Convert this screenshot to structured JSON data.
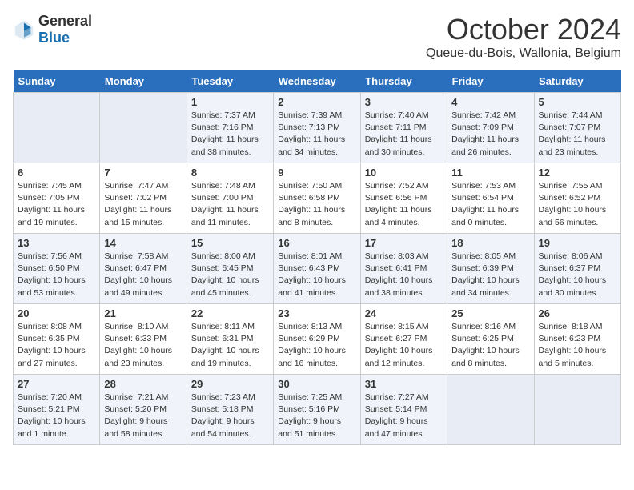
{
  "header": {
    "logo_general": "General",
    "logo_blue": "Blue",
    "month": "October 2024",
    "location": "Queue-du-Bois, Wallonia, Belgium"
  },
  "weekdays": [
    "Sunday",
    "Monday",
    "Tuesday",
    "Wednesday",
    "Thursday",
    "Friday",
    "Saturday"
  ],
  "weeks": [
    [
      {
        "day": "",
        "empty": true
      },
      {
        "day": "",
        "empty": true
      },
      {
        "day": "1",
        "sunrise": "Sunrise: 7:37 AM",
        "sunset": "Sunset: 7:16 PM",
        "daylight": "Daylight: 11 hours and 38 minutes."
      },
      {
        "day": "2",
        "sunrise": "Sunrise: 7:39 AM",
        "sunset": "Sunset: 7:13 PM",
        "daylight": "Daylight: 11 hours and 34 minutes."
      },
      {
        "day": "3",
        "sunrise": "Sunrise: 7:40 AM",
        "sunset": "Sunset: 7:11 PM",
        "daylight": "Daylight: 11 hours and 30 minutes."
      },
      {
        "day": "4",
        "sunrise": "Sunrise: 7:42 AM",
        "sunset": "Sunset: 7:09 PM",
        "daylight": "Daylight: 11 hours and 26 minutes."
      },
      {
        "day": "5",
        "sunrise": "Sunrise: 7:44 AM",
        "sunset": "Sunset: 7:07 PM",
        "daylight": "Daylight: 11 hours and 23 minutes."
      }
    ],
    [
      {
        "day": "6",
        "sunrise": "Sunrise: 7:45 AM",
        "sunset": "Sunset: 7:05 PM",
        "daylight": "Daylight: 11 hours and 19 minutes."
      },
      {
        "day": "7",
        "sunrise": "Sunrise: 7:47 AM",
        "sunset": "Sunset: 7:02 PM",
        "daylight": "Daylight: 11 hours and 15 minutes."
      },
      {
        "day": "8",
        "sunrise": "Sunrise: 7:48 AM",
        "sunset": "Sunset: 7:00 PM",
        "daylight": "Daylight: 11 hours and 11 minutes."
      },
      {
        "day": "9",
        "sunrise": "Sunrise: 7:50 AM",
        "sunset": "Sunset: 6:58 PM",
        "daylight": "Daylight: 11 hours and 8 minutes."
      },
      {
        "day": "10",
        "sunrise": "Sunrise: 7:52 AM",
        "sunset": "Sunset: 6:56 PM",
        "daylight": "Daylight: 11 hours and 4 minutes."
      },
      {
        "day": "11",
        "sunrise": "Sunrise: 7:53 AM",
        "sunset": "Sunset: 6:54 PM",
        "daylight": "Daylight: 11 hours and 0 minutes."
      },
      {
        "day": "12",
        "sunrise": "Sunrise: 7:55 AM",
        "sunset": "Sunset: 6:52 PM",
        "daylight": "Daylight: 10 hours and 56 minutes."
      }
    ],
    [
      {
        "day": "13",
        "sunrise": "Sunrise: 7:56 AM",
        "sunset": "Sunset: 6:50 PM",
        "daylight": "Daylight: 10 hours and 53 minutes."
      },
      {
        "day": "14",
        "sunrise": "Sunrise: 7:58 AM",
        "sunset": "Sunset: 6:47 PM",
        "daylight": "Daylight: 10 hours and 49 minutes."
      },
      {
        "day": "15",
        "sunrise": "Sunrise: 8:00 AM",
        "sunset": "Sunset: 6:45 PM",
        "daylight": "Daylight: 10 hours and 45 minutes."
      },
      {
        "day": "16",
        "sunrise": "Sunrise: 8:01 AM",
        "sunset": "Sunset: 6:43 PM",
        "daylight": "Daylight: 10 hours and 41 minutes."
      },
      {
        "day": "17",
        "sunrise": "Sunrise: 8:03 AM",
        "sunset": "Sunset: 6:41 PM",
        "daylight": "Daylight: 10 hours and 38 minutes."
      },
      {
        "day": "18",
        "sunrise": "Sunrise: 8:05 AM",
        "sunset": "Sunset: 6:39 PM",
        "daylight": "Daylight: 10 hours and 34 minutes."
      },
      {
        "day": "19",
        "sunrise": "Sunrise: 8:06 AM",
        "sunset": "Sunset: 6:37 PM",
        "daylight": "Daylight: 10 hours and 30 minutes."
      }
    ],
    [
      {
        "day": "20",
        "sunrise": "Sunrise: 8:08 AM",
        "sunset": "Sunset: 6:35 PM",
        "daylight": "Daylight: 10 hours and 27 minutes."
      },
      {
        "day": "21",
        "sunrise": "Sunrise: 8:10 AM",
        "sunset": "Sunset: 6:33 PM",
        "daylight": "Daylight: 10 hours and 23 minutes."
      },
      {
        "day": "22",
        "sunrise": "Sunrise: 8:11 AM",
        "sunset": "Sunset: 6:31 PM",
        "daylight": "Daylight: 10 hours and 19 minutes."
      },
      {
        "day": "23",
        "sunrise": "Sunrise: 8:13 AM",
        "sunset": "Sunset: 6:29 PM",
        "daylight": "Daylight: 10 hours and 16 minutes."
      },
      {
        "day": "24",
        "sunrise": "Sunrise: 8:15 AM",
        "sunset": "Sunset: 6:27 PM",
        "daylight": "Daylight: 10 hours and 12 minutes."
      },
      {
        "day": "25",
        "sunrise": "Sunrise: 8:16 AM",
        "sunset": "Sunset: 6:25 PM",
        "daylight": "Daylight: 10 hours and 8 minutes."
      },
      {
        "day": "26",
        "sunrise": "Sunrise: 8:18 AM",
        "sunset": "Sunset: 6:23 PM",
        "daylight": "Daylight: 10 hours and 5 minutes."
      }
    ],
    [
      {
        "day": "27",
        "sunrise": "Sunrise: 7:20 AM",
        "sunset": "Sunset: 5:21 PM",
        "daylight": "Daylight: 10 hours and 1 minute."
      },
      {
        "day": "28",
        "sunrise": "Sunrise: 7:21 AM",
        "sunset": "Sunset: 5:20 PM",
        "daylight": "Daylight: 9 hours and 58 minutes."
      },
      {
        "day": "29",
        "sunrise": "Sunrise: 7:23 AM",
        "sunset": "Sunset: 5:18 PM",
        "daylight": "Daylight: 9 hours and 54 minutes."
      },
      {
        "day": "30",
        "sunrise": "Sunrise: 7:25 AM",
        "sunset": "Sunset: 5:16 PM",
        "daylight": "Daylight: 9 hours and 51 minutes."
      },
      {
        "day": "31",
        "sunrise": "Sunrise: 7:27 AM",
        "sunset": "Sunset: 5:14 PM",
        "daylight": "Daylight: 9 hours and 47 minutes."
      },
      {
        "day": "",
        "empty": true
      },
      {
        "day": "",
        "empty": true
      }
    ]
  ]
}
